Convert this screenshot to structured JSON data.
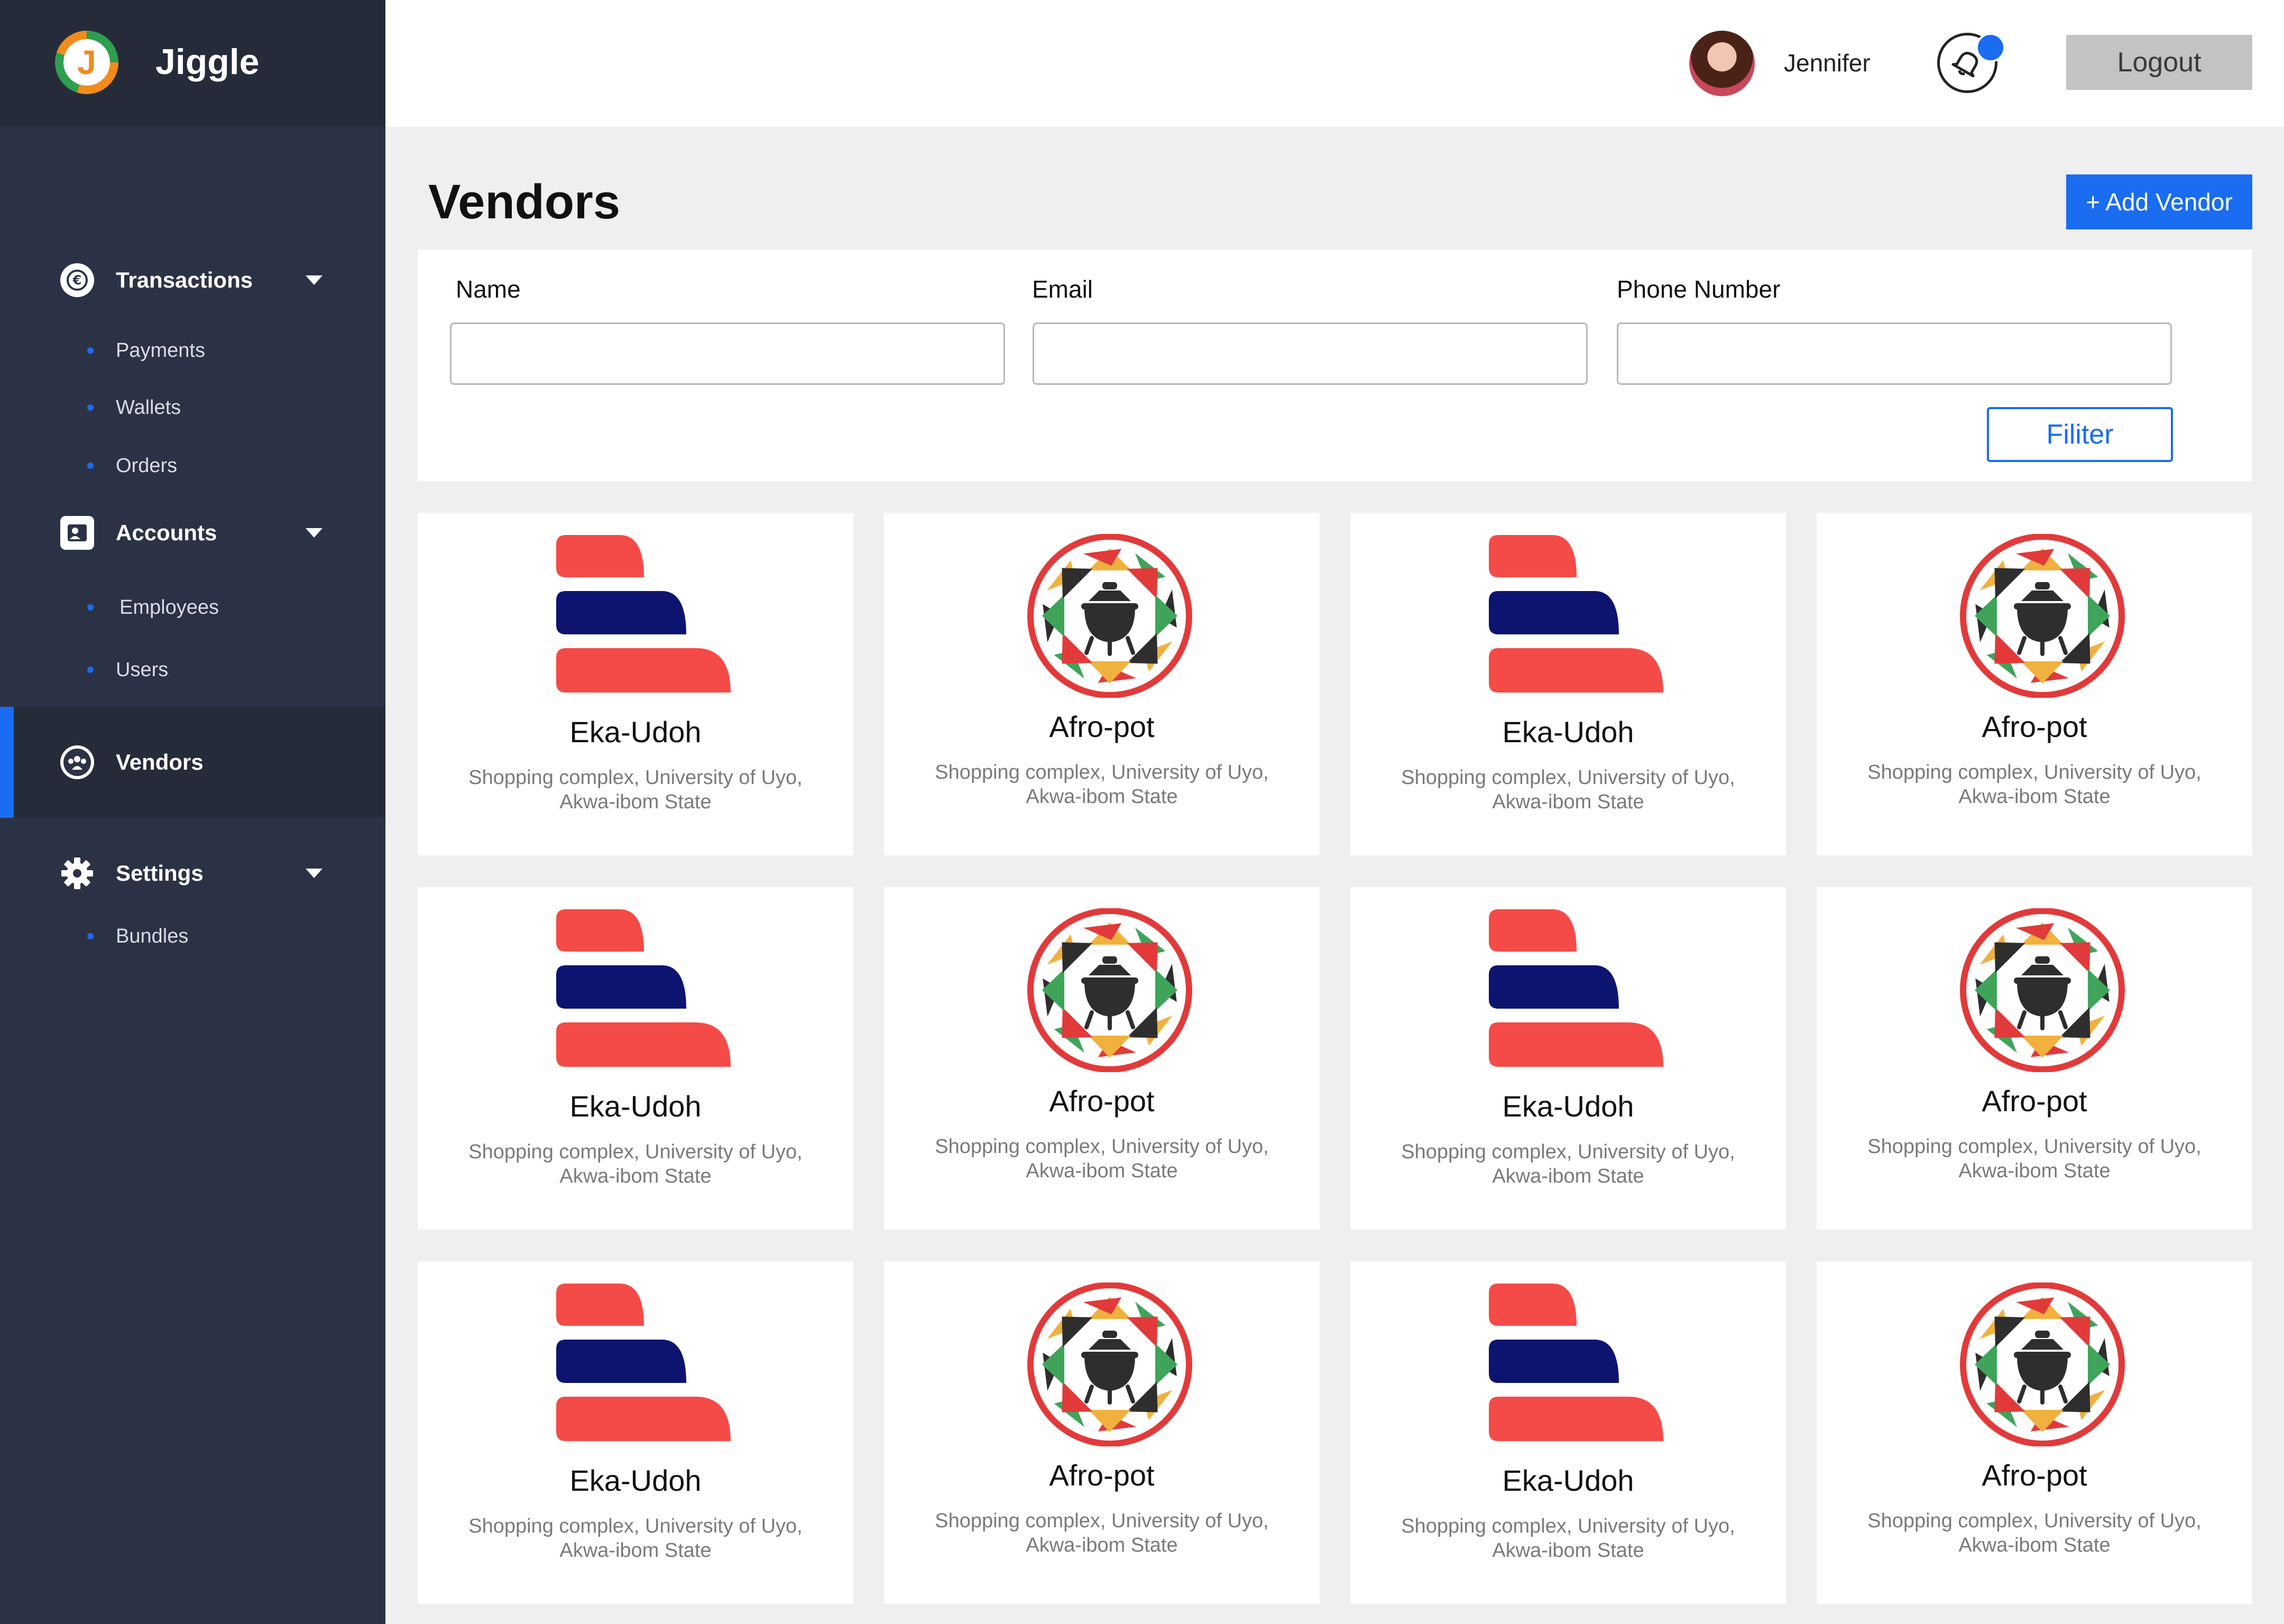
{
  "brand": {
    "name": "Jiggle",
    "logo_letter": "J"
  },
  "sidebar": {
    "sections": [
      {
        "label": "Transactions",
        "icon": "currency-icon",
        "items": [
          "Payments",
          "Wallets",
          "Orders"
        ]
      },
      {
        "label": "Accounts",
        "icon": "contact-card-icon",
        "items": [
          "Employees",
          "Users"
        ]
      },
      {
        "label": "Vendors",
        "icon": "people-group-icon",
        "active": true,
        "items": []
      },
      {
        "label": "Settings",
        "icon": "gear-icon",
        "items": [
          "Bundles"
        ]
      }
    ]
  },
  "header": {
    "user_name": "Jennifer",
    "logout_label": "Logout",
    "notification_icon": "bell-icon"
  },
  "page": {
    "title": "Vendors",
    "add_label": "+ Add Vendor"
  },
  "filters": {
    "name_label": "Name",
    "email_label": "Email",
    "phone_label": "Phone Number",
    "name_value": "",
    "email_value": "",
    "phone_value": "",
    "filter_label": "Filiter"
  },
  "colors": {
    "sidebar_bg": "#2c3245",
    "accent": "#1a6cf0",
    "eka_red": "#f44b48",
    "eka_navy": "#0d1470"
  },
  "vendors": [
    {
      "name": "Eka-Udoh",
      "address_line1": "Shopping complex, University of Uyo,",
      "address_line2": "Akwa-ibom State",
      "logo": "eka-udoh-logo"
    },
    {
      "name": "Afro-pot",
      "address_line1": "Shopping complex, University of Uyo,",
      "address_line2": "Akwa-ibom State",
      "logo": "afro-pot-logo"
    },
    {
      "name": "Eka-Udoh",
      "address_line1": "Shopping complex, University of Uyo,",
      "address_line2": "Akwa-ibom State",
      "logo": "eka-udoh-logo"
    },
    {
      "name": "Afro-pot",
      "address_line1": "Shopping complex, University of Uyo,",
      "address_line2": "Akwa-ibom State",
      "logo": "afro-pot-logo"
    },
    {
      "name": "Eka-Udoh",
      "address_line1": "Shopping complex, University of Uyo,",
      "address_line2": "Akwa-ibom State",
      "logo": "eka-udoh-logo"
    },
    {
      "name": "Afro-pot",
      "address_line1": "Shopping complex, University of Uyo,",
      "address_line2": "Akwa-ibom State",
      "logo": "afro-pot-logo"
    },
    {
      "name": "Eka-Udoh",
      "address_line1": "Shopping complex, University of Uyo,",
      "address_line2": "Akwa-ibom State",
      "logo": "eka-udoh-logo"
    },
    {
      "name": "Afro-pot",
      "address_line1": "Shopping complex, University of Uyo,",
      "address_line2": "Akwa-ibom State",
      "logo": "afro-pot-logo"
    },
    {
      "name": "Eka-Udoh",
      "address_line1": "Shopping complex, University of Uyo,",
      "address_line2": "Akwa-ibom State",
      "logo": "eka-udoh-logo"
    },
    {
      "name": "Afro-pot",
      "address_line1": "Shopping complex, University of Uyo,",
      "address_line2": "Akwa-ibom State",
      "logo": "afro-pot-logo"
    },
    {
      "name": "Eka-Udoh",
      "address_line1": "Shopping complex, University of Uyo,",
      "address_line2": "Akwa-ibom State",
      "logo": "eka-udoh-logo"
    },
    {
      "name": "Afro-pot",
      "address_line1": "Shopping complex, University of Uyo,",
      "address_line2": "Akwa-ibom State",
      "logo": "afro-pot-logo"
    }
  ]
}
